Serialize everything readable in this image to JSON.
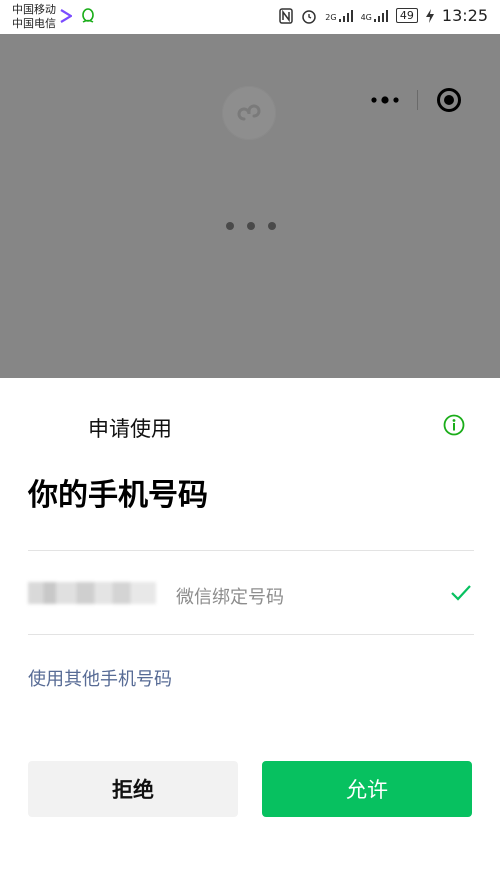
{
  "status_bar": {
    "carrier_1": "中国移动",
    "carrier_2": "中国电信",
    "network_1": "2G",
    "network_2": "4G",
    "battery": "49",
    "time": "13:25",
    "icons": [
      "arrow-app-icon",
      "qq-icon",
      "nfc-icon",
      "alarm-icon",
      "signal-icon",
      "charging-icon"
    ]
  },
  "miniprogram": {
    "logo_icon": "miniprogram-logo-icon",
    "loading": "loading-dots"
  },
  "dialog": {
    "app_line": "申请使用",
    "info_icon": "info-icon",
    "title": "你的手机号码",
    "phone_option": {
      "label": "微信绑定号码",
      "selected": true
    },
    "other_number_link": "使用其他手机号码",
    "deny_button": "拒绝",
    "allow_button": "允许"
  },
  "colors": {
    "accent_green": "#07c160",
    "link_blue": "#576b95",
    "overlay_gray": "#868686",
    "info_green": "#1aad19"
  }
}
